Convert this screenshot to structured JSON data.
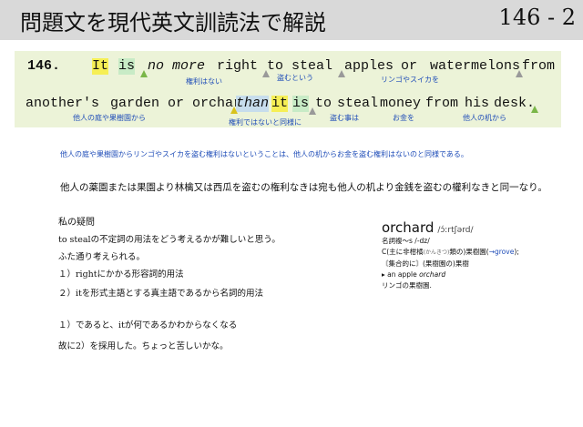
{
  "header": {
    "title": "問題文を現代英文訓読法で解説",
    "page_number": "146 - 2"
  },
  "sentence": {
    "number": "146.",
    "line1": [
      "It",
      "is",
      "no",
      "more",
      "right",
      "to",
      "steal",
      "apples",
      "or",
      "watermelons",
      "from"
    ],
    "line2": [
      "another's",
      "garden",
      "or",
      "orchard",
      "than",
      "it",
      "is",
      "to",
      "steal",
      "money",
      "from",
      "his",
      "desk."
    ],
    "notes": {
      "kenri": "権利はない",
      "nusumu_toiu": "盗むという",
      "ringo": "リンゴやスイカを",
      "niwa": "他人の庭や果樹園から",
      "onaji": "権利ではないと同様に",
      "nusumu_koto": "盗む事は",
      "okane": "お金を",
      "tsukue": "他人の机から"
    }
  },
  "translation": "他人の庭や果樹園からリンゴやスイカを盗む権利はないということは、他人の机からお金を盗む権利はないのと同様である。",
  "classical_reading": "他人の薬園または果園より林檎又は西瓜を盗むの権利なきは宛も他人の机より金銭を盗むの權利なきと同一なり。",
  "doubts": {
    "title": "私の疑問",
    "lines": [
      "to stealの不定詞の用法をどう考えるかが難しいと思う。",
      "ふた通り考えられる。",
      "１）rightにかかる形容詞的用法",
      "２）itを形式主語とする真主語であるから名詞的用法",
      "１）であると、itが何であるかわからなくなる",
      "故に2）を採用した。ちょっと苦しいかな。"
    ]
  },
  "dictionary": {
    "headword": "orchard",
    "pronunciation": "/ɔ́ːrtʃərd/",
    "plural": "名詞複〜s /-dz/",
    "sense_prefix": "C(主に非柑橘",
    "sense_ruby": "(かんきつ)",
    "sense_suffix": "類の)果樹園(",
    "sense_link": "→grove",
    "sense_end": ");",
    "collective": "〘集合的に〙(果樹園の)果樹",
    "example_en_prefix": "an apple ",
    "example_en_word": "orchard",
    "example_ja": "リンゴの果樹園."
  }
}
